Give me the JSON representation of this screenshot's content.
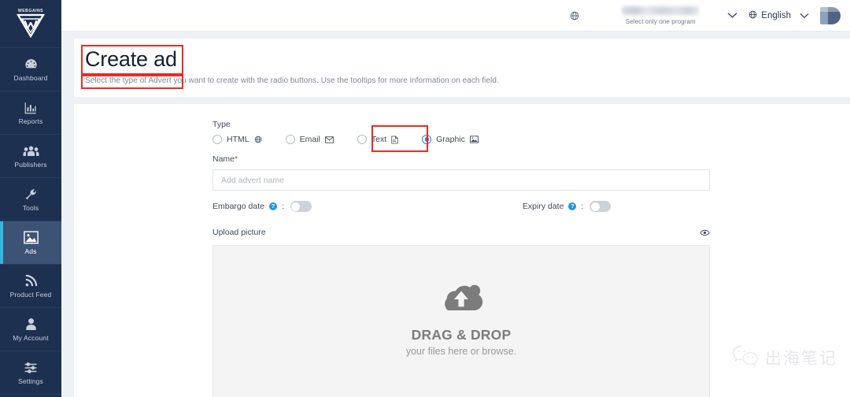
{
  "sidebar": {
    "brand": {
      "wordmark": "WEBGAINS",
      "icon": "webgains-shield-logo"
    },
    "items": [
      {
        "label": "Dashboard",
        "icon": "dashboard-gauge-icon",
        "active": false
      },
      {
        "label": "Reports",
        "icon": "bar-chart-icon",
        "active": false
      },
      {
        "label": "Publishers",
        "icon": "people-group-icon",
        "active": false
      },
      {
        "label": "Tools",
        "icon": "wrench-icon",
        "active": false
      },
      {
        "label": "Ads",
        "icon": "image-picture-icon",
        "active": true
      },
      {
        "label": "Product Feed",
        "icon": "rss-feed-icon",
        "active": false
      },
      {
        "label": "My Account",
        "icon": "user-person-icon",
        "active": false
      },
      {
        "label": "Settings",
        "icon": "sliders-settings-icon",
        "active": false
      }
    ]
  },
  "topbar": {
    "globe_icon": "globe-icon",
    "program_caption": "Select only one program",
    "program_value": "",
    "language": "English",
    "language_icon": "globe-icon",
    "chevron_icon": "chevron-down-icon",
    "avatar_icon": "user-avatar"
  },
  "page": {
    "title": "Create ad",
    "subtitle": "Select the type of Advert you want to create with the radio buttons. Use the tooltips for more information on each field."
  },
  "form": {
    "type_label": "Type",
    "type_options": [
      {
        "label": "HTML",
        "icon": "globe-icon",
        "selected": false
      },
      {
        "label": "Email",
        "icon": "envelope-icon",
        "selected": false
      },
      {
        "label": "Text",
        "icon": "document-icon",
        "selected": false
      },
      {
        "label": "Graphic",
        "icon": "image-icon",
        "selected": true
      }
    ],
    "name_label": "Name",
    "name_required_mark": "*",
    "name_value": "",
    "name_placeholder": "Add advert name",
    "embargo_label": "Embargo date",
    "embargo_info_icon": "info-question-icon",
    "embargo_colon": ":",
    "embargo_on": false,
    "expiry_label": "Expiry date",
    "expiry_info_icon": "info-question-icon",
    "expiry_colon": ":",
    "expiry_on": false,
    "upload_label": "Upload picture",
    "preview_icon": "eye-icon",
    "dropzone_icon": "cloud-upload-icon",
    "dropzone_title": "DRAG & DROP",
    "dropzone_subtitle": "your files here or browse."
  },
  "watermark": {
    "icon": "wechat-icon",
    "text": "出海笔记"
  },
  "colors": {
    "sidebar_bg": "#1e3050",
    "sidebar_active_bg": "#3d5375",
    "sidebar_accent": "#33b6e0",
    "page_bg": "#eef1f5",
    "card_bg": "#ffffff",
    "highlight_box": "#f2281f",
    "radio_selected": "#2b7fd4",
    "info_icon": "#2196e3",
    "required_star": "#e8342b",
    "dropzone_bg": "#f4f4f4"
  }
}
